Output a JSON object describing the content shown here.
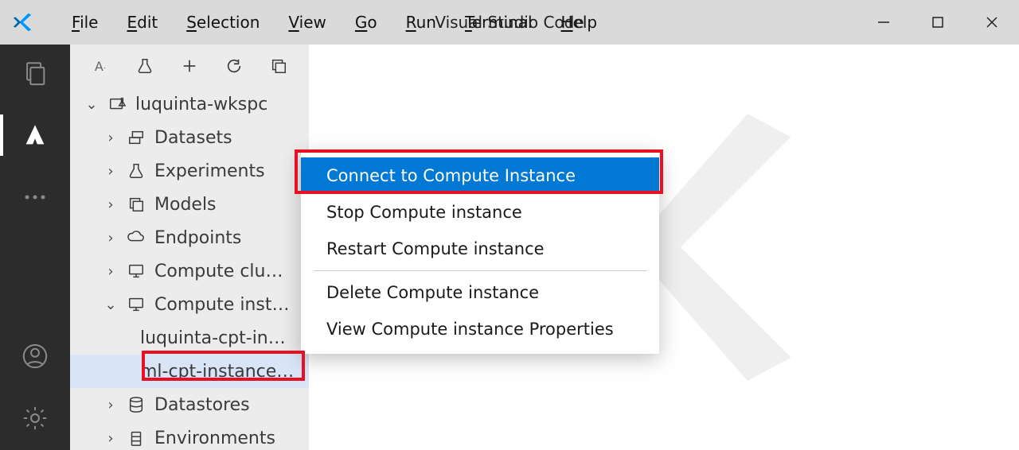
{
  "window": {
    "title": "Visual Studio Code"
  },
  "menu": {
    "file": "File",
    "edit": "Edit",
    "selection": "Selection",
    "view": "View",
    "go": "Go",
    "run": "Run",
    "terminal": "Terminal",
    "help": "Help"
  },
  "toolbar_label": "A",
  "tree": {
    "workspace": "luquinta-wkspc",
    "datasets": "Datasets",
    "experiments": "Experiments",
    "models": "Models",
    "endpoints": "Endpoints",
    "compute_clusters": "Compute clu…",
    "compute_instances": "Compute inst…",
    "instance1": "luquinta-cpt-in…",
    "instance2": "ml-cpt-instance…",
    "datastores": "Datastores",
    "environments": "Environments"
  },
  "context_menu": {
    "connect": "Connect to Compute Instance",
    "stop": "Stop Compute instance",
    "restart": "Restart Compute instance",
    "delete": "Delete Compute instance",
    "props": "View Compute instance Properties"
  }
}
